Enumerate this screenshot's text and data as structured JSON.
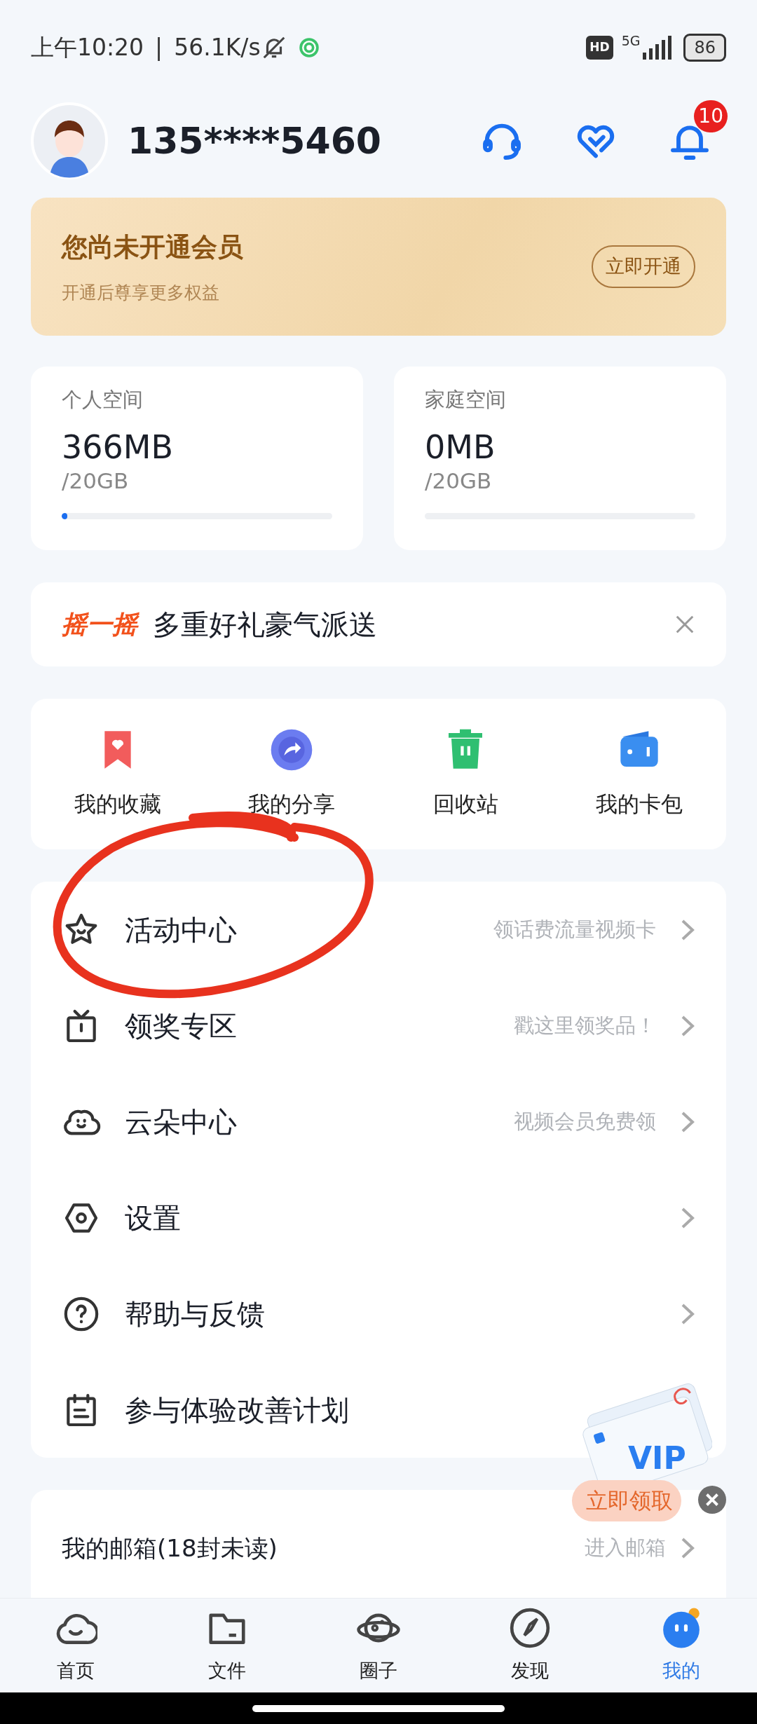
{
  "status_bar": {
    "time": "上午10:20",
    "separator": "|",
    "speed": "56.1K/s",
    "hd": "HD",
    "network": "5G",
    "battery": "86"
  },
  "profile": {
    "phone": "135****5460",
    "notification_count": "10"
  },
  "vip_banner": {
    "title": "您尚未开通会员",
    "subtitle": "开通后尊享更多权益",
    "button": "立即开通"
  },
  "storage": [
    {
      "label": "个人空间",
      "used": "366MB",
      "total": "/20GB",
      "level": 0.02
    },
    {
      "label": "家庭空间",
      "used": "0MB",
      "total": "/20GB",
      "level": 0
    }
  ],
  "promo_banner": {
    "tag": "摇一摇",
    "text": "多重好礼豪气派送"
  },
  "tools": [
    {
      "kind": "favorites",
      "label": "我的收藏"
    },
    {
      "kind": "share",
      "label": "我的分享"
    },
    {
      "kind": "recycle",
      "label": "回收站"
    },
    {
      "kind": "wallet",
      "label": "我的卡包"
    }
  ],
  "menu": [
    {
      "kind": "star",
      "label": "活动中心",
      "hint": "领话费流量视频卡"
    },
    {
      "kind": "gift",
      "label": "领奖专区",
      "hint": "戳这里领奖品！"
    },
    {
      "kind": "cloud",
      "label": "云朵中心",
      "hint": "视频会员免费领"
    },
    {
      "kind": "settings",
      "label": "设置",
      "arrow": true
    },
    {
      "kind": "help",
      "label": "帮助与反馈",
      "arrow": true
    },
    {
      "kind": "plan",
      "label": "参与体验改善计划",
      "arrow": false
    }
  ],
  "mailbox": {
    "label": "我的邮箱(18封未读)",
    "action": "进入邮箱"
  },
  "floating_promo": {
    "card_text": "VIP",
    "button": "立即领取"
  },
  "tab_bar": [
    {
      "kind": "home",
      "label": "首页",
      "selected": false
    },
    {
      "kind": "files",
      "label": "文件",
      "selected": false
    },
    {
      "kind": "circle",
      "label": "圈子",
      "selected": false
    },
    {
      "kind": "discover",
      "label": "发现",
      "selected": false
    },
    {
      "kind": "me",
      "label": "我的",
      "selected": true
    }
  ]
}
